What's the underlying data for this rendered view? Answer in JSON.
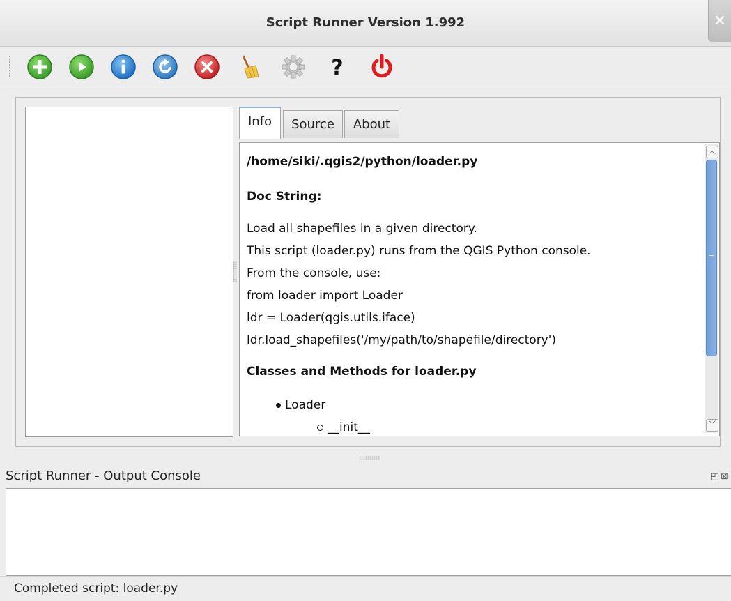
{
  "window": {
    "title": "Script Runner Version 1.992",
    "close_glyph": "×"
  },
  "toolbar": {
    "buttons": [
      {
        "icon": "add-icon",
        "color": "#4caf3a"
      },
      {
        "icon": "run-icon",
        "color": "#4caf3a"
      },
      {
        "icon": "info-icon",
        "color": "#2f86d6"
      },
      {
        "icon": "reload-icon",
        "color": "#3b8fd0"
      },
      {
        "icon": "remove-icon",
        "color": "#d93a3a"
      },
      {
        "icon": "clear-broom-icon",
        "color": "#e2b03a"
      },
      {
        "icon": "settings-gear-icon",
        "color": "#c8c8c8"
      },
      {
        "icon": "help-icon",
        "color": "#111111"
      },
      {
        "icon": "power-icon",
        "color": "#e01b1b"
      }
    ]
  },
  "tabs": {
    "info": "Info",
    "source": "Source",
    "about": "About"
  },
  "info": {
    "path": "/home/siki/.qgis2/python/loader.py",
    "doc_heading": "Doc String:",
    "doc_lines": [
      "Load all shapefiles in a given directory.",
      "This script (loader.py) runs from the QGIS Python console.",
      "From the console, use:",
      "from loader import Loader",
      "ldr = Loader(qgis.utils.iface)",
      "ldr.load_shapefiles('/my/path/to/shapefile/directory')"
    ],
    "classes_heading": "Classes and Methods for loader.py",
    "class_item": "Loader",
    "method_item": "__init__"
  },
  "console": {
    "title": "Script Runner - Output Console",
    "dock_glyphs": "◰⊠"
  },
  "status": {
    "text": "Completed script: loader.py"
  }
}
